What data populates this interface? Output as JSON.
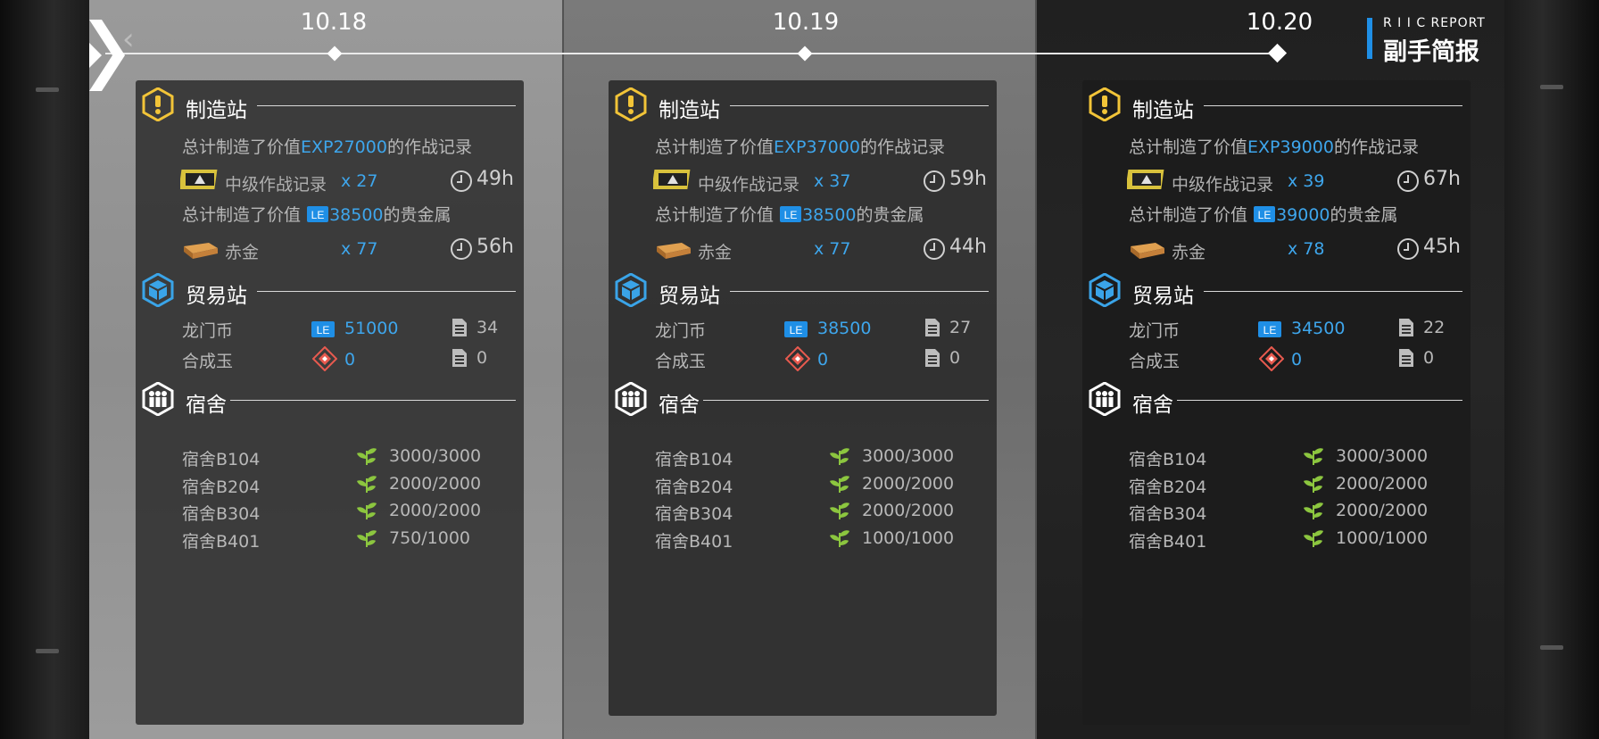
{
  "header": {
    "report_small": "R I I C REPORT",
    "report_title": "副手简报"
  },
  "columns": [
    {
      "date": "10.18",
      "manufacture": {
        "title": "制造站",
        "exp_line_prefix": "总计制造了价值",
        "exp_value": "EXP27000",
        "exp_line_suffix": "的作战记录",
        "record_item": "中级作战记录",
        "record_count": "x 27",
        "record_time": "49h",
        "metal_line_prefix": "总计制造了价值",
        "metal_value": "38500",
        "metal_line_suffix": "的贵金属",
        "gold_item": "赤金",
        "gold_count": "x 77",
        "gold_time": "56h"
      },
      "trade": {
        "title": "贸易站",
        "lmd_label": "龙门币",
        "lmd_value": "51000",
        "lmd_orders": "34",
        "orundum_label": "合成玉",
        "orundum_value": "0",
        "orundum_orders": "0"
      },
      "dorm": {
        "title": "宿舍",
        "rows": [
          {
            "name": "宿舍B104",
            "value": "3000/3000"
          },
          {
            "name": "宿舍B204",
            "value": "2000/2000"
          },
          {
            "name": "宿舍B304",
            "value": "2000/2000"
          },
          {
            "name": "宿舍B401",
            "value": "750/1000"
          }
        ]
      }
    },
    {
      "date": "10.19",
      "manufacture": {
        "title": "制造站",
        "exp_line_prefix": "总计制造了价值",
        "exp_value": "EXP37000",
        "exp_line_suffix": "的作战记录",
        "record_item": "中级作战记录",
        "record_count": "x 37",
        "record_time": "59h",
        "metal_line_prefix": "总计制造了价值",
        "metal_value": "38500",
        "metal_line_suffix": "的贵金属",
        "gold_item": "赤金",
        "gold_count": "x 77",
        "gold_time": "44h"
      },
      "trade": {
        "title": "贸易站",
        "lmd_label": "龙门币",
        "lmd_value": "38500",
        "lmd_orders": "27",
        "orundum_label": "合成玉",
        "orundum_value": "0",
        "orundum_orders": "0"
      },
      "dorm": {
        "title": "宿舍",
        "rows": [
          {
            "name": "宿舍B104",
            "value": "3000/3000"
          },
          {
            "name": "宿舍B204",
            "value": "2000/2000"
          },
          {
            "name": "宿舍B304",
            "value": "2000/2000"
          },
          {
            "name": "宿舍B401",
            "value": "1000/1000"
          }
        ]
      }
    },
    {
      "date": "10.20",
      "manufacture": {
        "title": "制造站",
        "exp_line_prefix": "总计制造了价值",
        "exp_value": "EXP39000",
        "exp_line_suffix": "的作战记录",
        "record_item": "中级作战记录",
        "record_count": "x 39",
        "record_time": "67h",
        "metal_line_prefix": "总计制造了价值",
        "metal_value": "39000",
        "metal_line_suffix": "的贵金属",
        "gold_item": "赤金",
        "gold_count": "x 78",
        "gold_time": "45h"
      },
      "trade": {
        "title": "贸易站",
        "lmd_label": "龙门币",
        "lmd_value": "34500",
        "lmd_orders": "22",
        "orundum_label": "合成玉",
        "orundum_value": "0",
        "orundum_orders": "0"
      },
      "dorm": {
        "title": "宿舍",
        "rows": [
          {
            "name": "宿舍B104",
            "value": "3000/3000"
          },
          {
            "name": "宿舍B204",
            "value": "2000/2000"
          },
          {
            "name": "宿舍B304",
            "value": "2000/2000"
          },
          {
            "name": "宿舍B401",
            "value": "1000/1000"
          }
        ]
      }
    }
  ],
  "colors": {
    "accent_blue": "#3ea6ec",
    "manufacture_icon": "#f2c438",
    "trade_icon": "#3aa4e8",
    "dorm_icon": "#ffffff",
    "leaf_green": "#8cc63f"
  },
  "icons": {
    "manufacture": "exclamation-badge-icon",
    "trade": "crate-icon",
    "dorm": "people-icon",
    "clock": "clock-icon",
    "lmd": "lmd-currency-icon",
    "orundum": "orundum-icon",
    "document": "document-icon",
    "leaf": "leaf-icon"
  }
}
